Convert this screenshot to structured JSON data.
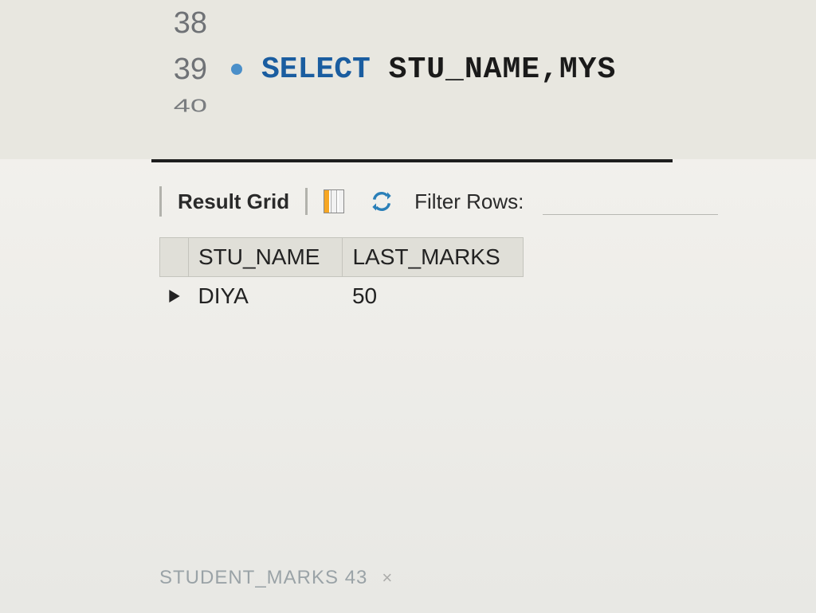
{
  "editor": {
    "lines": [
      {
        "num": "38",
        "has_dot": false,
        "segments": []
      },
      {
        "num": "39",
        "has_dot": true,
        "segments": [
          {
            "kind": "kw",
            "text": "SELECT"
          },
          {
            "kind": "sp",
            "text": " "
          },
          {
            "kind": "id",
            "text": "STU_NAME,MYS"
          }
        ]
      },
      {
        "num": "40",
        "has_dot": false,
        "segments": []
      }
    ]
  },
  "results": {
    "label": "Result Grid",
    "filter_label": "Filter Rows:",
    "filter_value": "",
    "columns": [
      "STU_NAME",
      "LAST_MARKS"
    ],
    "rows": [
      {
        "STU_NAME": "DIYA",
        "LAST_MARKS": "50"
      }
    ]
  },
  "tab": {
    "name": "STUDENT_MARKS 43"
  }
}
